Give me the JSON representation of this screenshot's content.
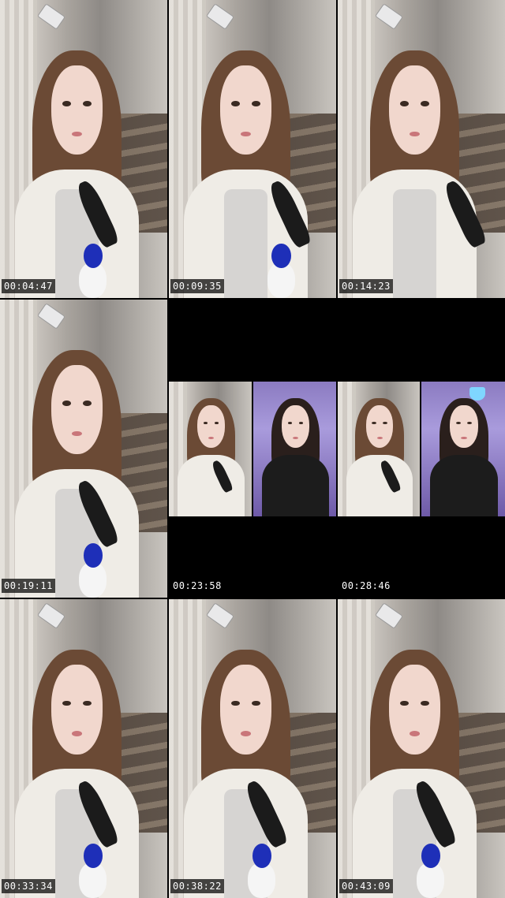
{
  "thumbnails": [
    {
      "timestamp": "00:04:47"
    },
    {
      "timestamp": "00:09:35"
    },
    {
      "timestamp": "00:14:23"
    },
    {
      "timestamp": "00:19:11"
    },
    {
      "timestamp": "00:23:58"
    },
    {
      "timestamp": "00:28:46"
    },
    {
      "timestamp": "00:33:34"
    },
    {
      "timestamp": "00:38:22"
    },
    {
      "timestamp": "00:43:09"
    }
  ]
}
